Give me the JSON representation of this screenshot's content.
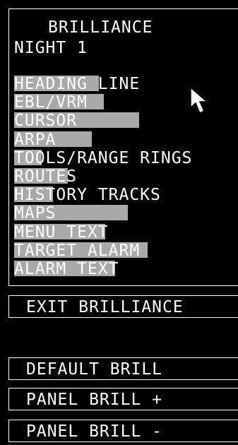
{
  "header": {
    "title": "BRILLIANCE",
    "mode": "NIGHT 1"
  },
  "items": [
    {
      "label": "HEADING LINE",
      "level": 0.52
    },
    {
      "label": "EBL/VRM",
      "level": 0.55
    },
    {
      "label": "CURSOR",
      "level": 0.77
    },
    {
      "label": "ARPA",
      "level": 0.48
    },
    {
      "label": "TOOLS/RANGE RINGS",
      "level": 0.17
    },
    {
      "label": "ROUTES",
      "level": 0.33
    },
    {
      "label": "HISTORY TRACKS",
      "level": 0.24
    },
    {
      "label": "MAPS",
      "level": 0.7
    },
    {
      "label": "MENU TEXT",
      "level": 0.56
    },
    {
      "label": "TARGET ALARM",
      "level": 0.82
    },
    {
      "label": "ALARM TEXT",
      "level": 0.62
    }
  ],
  "buttons": {
    "exit": "EXIT BRILLIANCE",
    "default": "DEFAULT BRILL",
    "panel_plus": "PANEL BRILL +",
    "panel_minus": "PANEL BRILL -"
  },
  "colors": {
    "background": "#000000",
    "text": "#ffffff",
    "level_bar": "#a9a9a9"
  },
  "icons": {
    "cursor": "arrow-pointer-icon"
  }
}
